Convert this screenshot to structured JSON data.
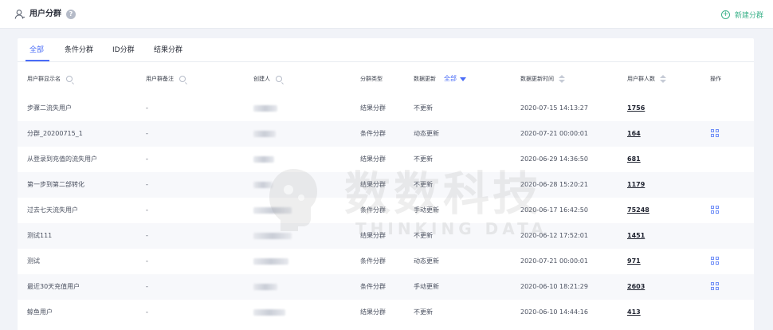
{
  "header": {
    "title": "用户分群",
    "help_glyph": "?",
    "new_button_label": "新建分群",
    "new_button_glyph": "+"
  },
  "tabs": [
    {
      "label": "全部",
      "active": true
    },
    {
      "label": "条件分群",
      "active": false
    },
    {
      "label": "ID分群",
      "active": false
    },
    {
      "label": "结果分群",
      "active": false
    }
  ],
  "table": {
    "columns": {
      "name": "用户群显示名",
      "remark": "用户群备注",
      "creator": "创建人",
      "type": "分群类型",
      "update": "数据更新",
      "update_filter": "全部",
      "update_time": "数据更新时间",
      "count": "用户群人数",
      "action": "操作"
    },
    "rows": [
      {
        "name": "步骤二流失用户",
        "remark": "-",
        "type": "结果分群",
        "update": "不更新",
        "time": "2020-07-15 14:13:27",
        "count": "1756",
        "has_action": false
      },
      {
        "name": "分群_20200715_1",
        "remark": "-",
        "type": "条件分群",
        "update": "动态更新",
        "time": "2020-07-21 00:00:01",
        "count": "164",
        "has_action": true
      },
      {
        "name": "从登录到充值的流失用户",
        "remark": "-",
        "type": "结果分群",
        "update": "不更新",
        "time": "2020-06-29 14:36:50",
        "count": "681",
        "has_action": false
      },
      {
        "name": "第一步到第二部转化",
        "remark": "-",
        "type": "结果分群",
        "update": "不更新",
        "time": "2020-06-28 15:20:21",
        "count": "1179",
        "has_action": false
      },
      {
        "name": "过去七天流失用户",
        "remark": "-",
        "type": "条件分群",
        "update": "手动更新",
        "time": "2020-06-17 16:42:50",
        "count": "75248",
        "has_action": true
      },
      {
        "name": "测试111",
        "remark": "-",
        "type": "结果分群",
        "update": "不更新",
        "time": "2020-06-12 17:52:01",
        "count": "1451",
        "has_action": false
      },
      {
        "name": "测试",
        "remark": "-",
        "type": "条件分群",
        "update": "动态更新",
        "time": "2020-07-21 00:00:01",
        "count": "971",
        "has_action": true
      },
      {
        "name": "最近30天充值用户",
        "remark": "-",
        "type": "条件分群",
        "update": "手动更新",
        "time": "2020-06-10 18:21:29",
        "count": "2603",
        "has_action": true
      },
      {
        "name": "鲸鱼用户",
        "remark": "-",
        "type": "结果分群",
        "update": "不更新",
        "time": "2020-06-10 14:44:16",
        "count": "413",
        "has_action": false
      }
    ]
  },
  "watermark": {
    "cn": "数数科技",
    "en": "THINKING DATA"
  },
  "colors": {
    "accent": "#4a6cf7",
    "new_button": "#3bb28a",
    "row_alt": "#f7f8fb"
  },
  "icons": {
    "page": "user-group-icon",
    "help": "help-icon",
    "new": "plus-circle-icon",
    "column_search": "search-icon",
    "column_sort": "sort-icon",
    "filter": "caret-down-icon",
    "row_action": "grid-icon"
  }
}
